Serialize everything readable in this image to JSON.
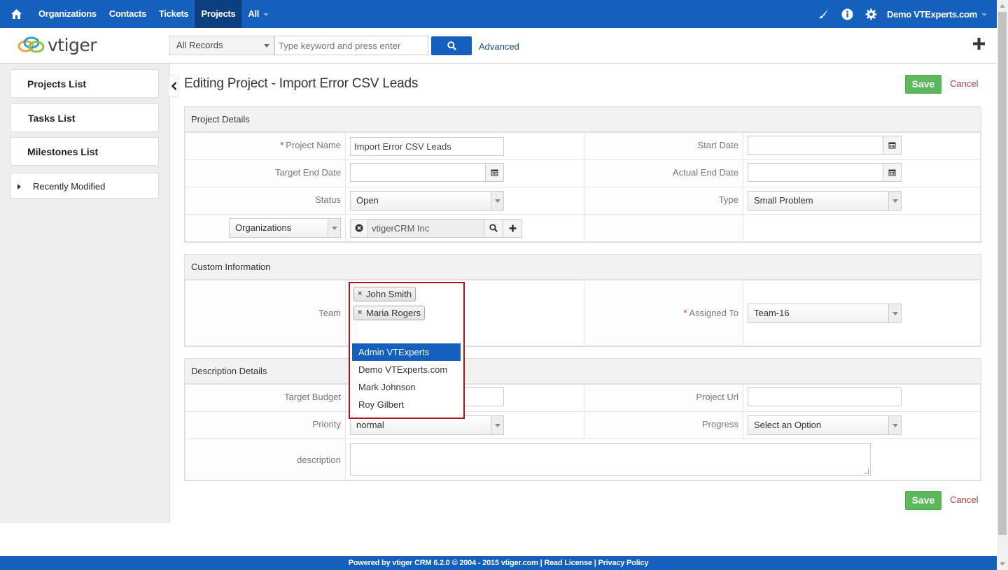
{
  "topnav": {
    "items": [
      "Organizations",
      "Contacts",
      "Tickets",
      "Projects",
      "All"
    ],
    "active": "Projects",
    "user": "Demo VTExperts.com",
    "icons": [
      "home-icon",
      "paintbrush-icon",
      "info-icon",
      "gear-icon"
    ]
  },
  "header": {
    "logo_text": "vtiger",
    "filter_value": "All Records",
    "search_placeholder": "Type keyword and press enter",
    "advanced_label": "Advanced"
  },
  "sidebar": {
    "items": [
      "Projects List",
      "Tasks List",
      "Milestones List"
    ],
    "recent": "Recently Modified"
  },
  "page": {
    "title": "Editing Project - Import Error CSV Leads",
    "save_label": "Save",
    "cancel_label": "Cancel"
  },
  "project_details": {
    "heading": "Project Details",
    "project_name_label": "Project Name",
    "project_name_value": "Import Error CSV Leads",
    "start_date_label": "Start Date",
    "target_end_label": "Target End Date",
    "actual_end_label": "Actual End Date",
    "status_label": "Status",
    "status_value": "Open",
    "type_label": "Type",
    "type_value": "Small Problem",
    "related_module": "Organizations",
    "related_value": "vtigerCRM Inc"
  },
  "custom_info": {
    "heading": "Custom Information",
    "team_label": "Team",
    "team_selected": [
      "John Smith",
      "Maria Rogers"
    ],
    "team_options": [
      "Admin VTExperts",
      "Demo VTExperts.com",
      "Mark Johnson",
      "Roy Gilbert"
    ],
    "assigned_label": "Assigned To",
    "assigned_value": "Team-16"
  },
  "description_details": {
    "heading": "Description Details",
    "budget_label": "Target Budget",
    "url_label": "Project Url",
    "priority_label": "Priority",
    "priority_value": "normal",
    "progress_label": "Progress",
    "progress_value": "Select an Option",
    "description_label": "description"
  },
  "footer": {
    "text": "Powered by vtiger CRM 6.2.0  © 2004 - 2015  vtiger.com | Read License | Privacy Policy"
  },
  "colors": {
    "brand_blue": "#1560bd",
    "save_green": "#5cb85c",
    "highlight_red": "#b0151c"
  }
}
